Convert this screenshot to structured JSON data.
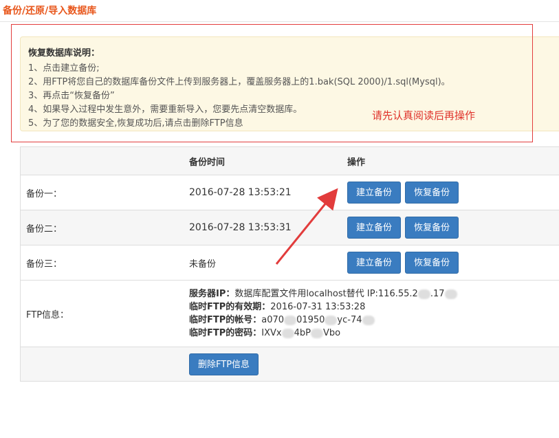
{
  "header": {
    "title": "备份/还原/导入数据库"
  },
  "notice": {
    "heading": "恢复数据库说明：",
    "lines": [
      "1、点击建立备份;",
      "2、用FTP将您自己的数据库备份文件上传到服务器上，覆盖服务器上的1.bak(SQL 2000)/1.sql(Mysql)。",
      "3、再点击“恢复备份”",
      "4、如果导入过程中发生意外，需要重新导入，您要先点清空数据库。",
      "5、为了您的数据安全,恢复成功后,请点击删除FTP信息"
    ],
    "annotation": "请先认真阅读后再操作"
  },
  "table": {
    "headers": {
      "time": "备份时间",
      "action": "操作"
    },
    "rows": [
      {
        "label": "备份一：",
        "time": "2016-07-28 13:53:21"
      },
      {
        "label": "备份二：",
        "time": "2016-07-28 13:53:31"
      },
      {
        "label": "备份三：",
        "time": "未备份"
      }
    ],
    "create_label": "建立备份",
    "restore_label": "恢复备份"
  },
  "ftp": {
    "label": "FTP信息：",
    "server_key": "服务器IP：",
    "server_val": "数据库配置文件用localhost替代 IP:116.55.2",
    "server_val_tail": ".17",
    "expiry_key": "临时FTP的有效期：",
    "expiry_val": "2016-07-31 13:53:28",
    "account_key": "临时FTP的帐号：",
    "account_val_a": "a070",
    "account_val_b": "01950",
    "account_val_c": "yc-74",
    "password_key": "临时FTP的密码：",
    "password_val_a": "IXVx",
    "password_val_b": "4bP",
    "password_val_c": "Vbo",
    "delete_label": "删除FTP信息"
  },
  "colors": {
    "accent": "#e8571c",
    "button": "#3a7cc0",
    "annotation": "#e0332b"
  }
}
